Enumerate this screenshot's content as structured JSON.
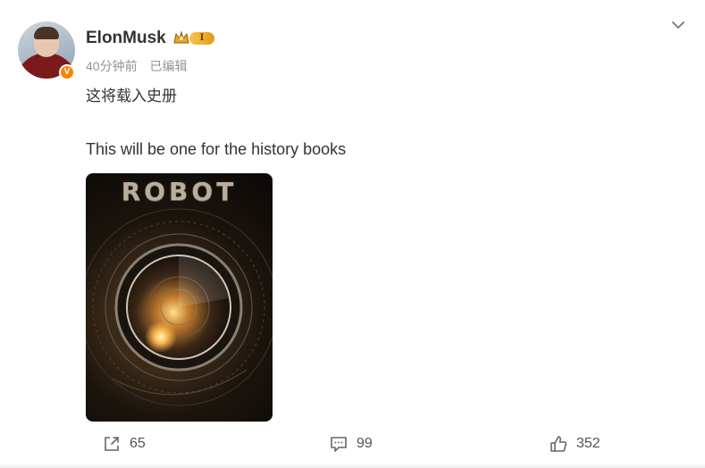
{
  "post": {
    "author": "ElonMusk",
    "vip_level": "I",
    "verified_mark": "V",
    "time": "40分钟前",
    "edited": "已编辑",
    "text_zh": "这将载入史册",
    "text_en": "This will be one for the history books",
    "image": {
      "title": "ROBOT",
      "icon": "camera-lens-poster"
    }
  },
  "actions": {
    "repost_count": "65",
    "comment_count": "99",
    "like_count": "352"
  },
  "icons": {
    "menu": "chevron-down-icon",
    "repost": "share-icon",
    "comment": "comment-icon",
    "like": "thumbs-up-icon"
  },
  "colors": {
    "verified": "#ff8200",
    "meta_text": "#939393",
    "vip_gold": "#f6c64a"
  }
}
